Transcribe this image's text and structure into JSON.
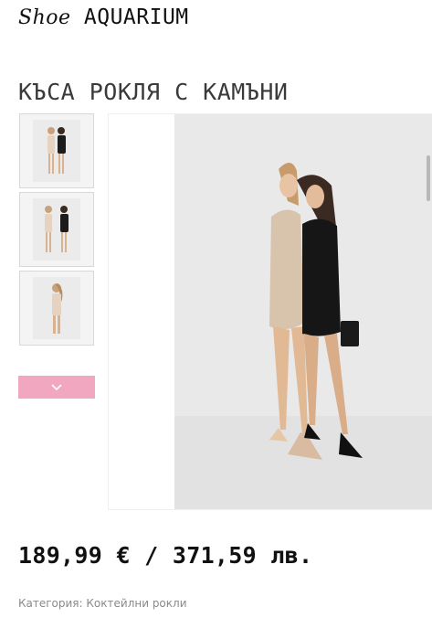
{
  "header": {
    "logo_shoe": "Shoe",
    "logo_aquarium": "AQUARIUM"
  },
  "product": {
    "title": "КЪСА РОКЛЯ С КАМЪНИ",
    "price": "189,99 € / 371,59 лв.",
    "category_label": "Категория:",
    "category_value": "Коктейлни рокли"
  },
  "gallery": {
    "thumbnail_count": 3,
    "next_icon": "chevron-down-icon"
  },
  "colors": {
    "accent_pink": "#f1a7c0",
    "text_dark": "#111111",
    "text_muted": "#8a8a8a"
  }
}
